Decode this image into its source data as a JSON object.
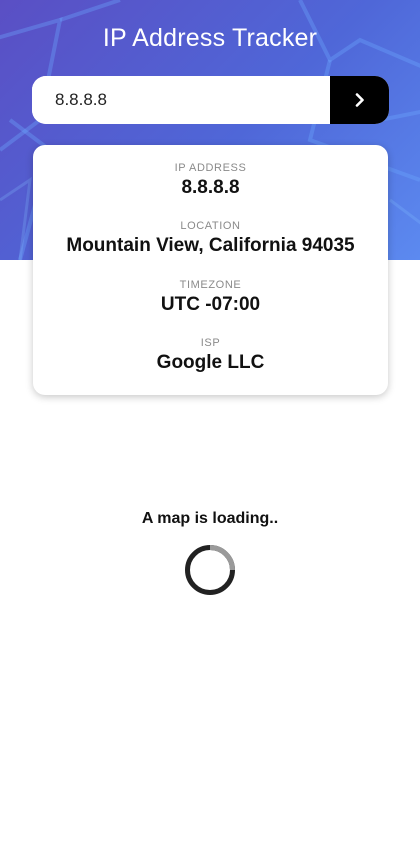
{
  "header": {
    "title": "IP Address Tracker"
  },
  "search": {
    "value": "8.8.8.8",
    "submit_icon": "chevron-right-icon"
  },
  "info": {
    "ip": {
      "label": "IP ADDRESS",
      "value": "8.8.8.8"
    },
    "location": {
      "label": "LOCATION",
      "value": "Mountain View, California 94035"
    },
    "timezone": {
      "label": "TIMEZONE",
      "value": "UTC -07:00"
    },
    "isp": {
      "label": "ISP",
      "value": "Google LLC"
    }
  },
  "map": {
    "loading_text": "A map is loading.."
  },
  "colors": {
    "hero_start": "#5a4fc4",
    "hero_end": "#5c8af0",
    "button": "#000000",
    "label": "#8a8a8a"
  }
}
